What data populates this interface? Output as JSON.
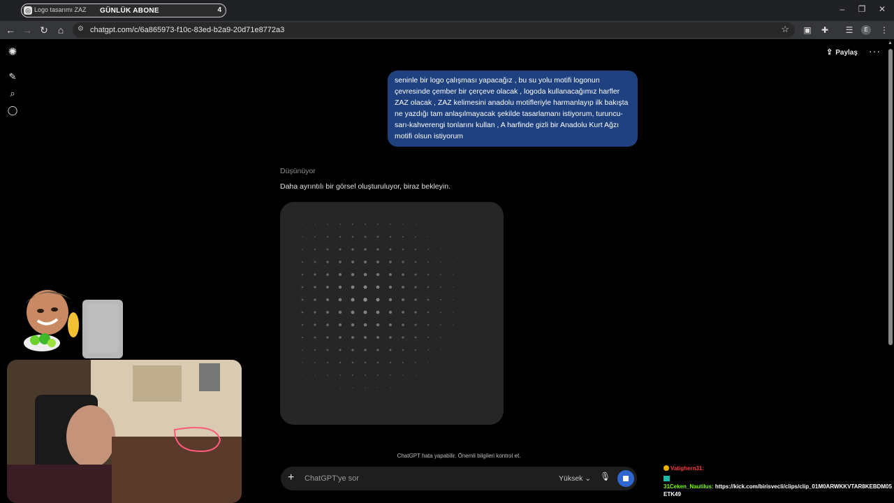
{
  "browser": {
    "tab_title": "Logo tasarımı ZAZ",
    "tab_overlay": "GÜNLÜK ABONE",
    "tab_count": "4",
    "url": "chatgpt.com/c/6a865973-f10c-83ed-b2a9-20d71e8772a3",
    "profile_initial": "E",
    "window_controls": [
      "–",
      "❐",
      "✕"
    ]
  },
  "header": {
    "share_label": "Paylaş",
    "more_label": "···"
  },
  "conversation": {
    "user_message": "seninle bir logo çalışması yapacağız , bu su yolu motifi logonun\nçevresinde çember bir çerçeve olacak , logoda kullanacağımız harfler\nZAZ olacak , ZAZ kelimesini anadolu motifleriyle harmanlayıp ilk bakışta\nne yazdığı tam anlaşılmayacak şekilde tasarlamanı istiyorum, turuncu-\nsarı-kahverengi tonlarını kullan , A harfinde gizli bir Anadolu Kurt Ağzı\nmotifi olsun istiyorum",
    "thinking_label": "Düşünüyor",
    "status_text": "Daha ayrıntılı bir görsel oluşturuluyor, biraz bekleyin."
  },
  "composer": {
    "disclaimer": "ChatGPT hata yapabilir. Önemli bilgileri kontrol et.",
    "placeholder": "ChatGPT'ye sor",
    "model_label": "Yüksek"
  },
  "stream_chat": {
    "line1_user": "Vatighern31:",
    "line2_user": "31Ceken_Nautilus:",
    "line2_text": "https://kick.com/birisvecli/clips/clip_01M0ARWKKVTAR8KEBDM05ETK49"
  },
  "colors": {
    "user_bubble": "#1f4180",
    "stop_button": "#2f66d0",
    "image_placeholder": "#262626"
  }
}
